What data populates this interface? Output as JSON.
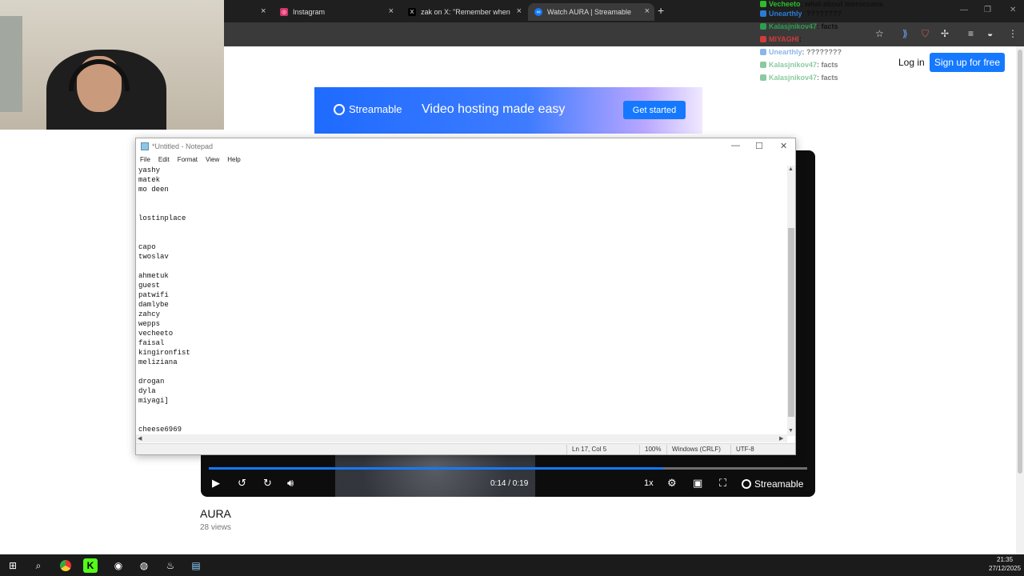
{
  "browser": {
    "tabs": [
      {
        "title": "Instagram",
        "icon": "instagram-icon",
        "active": false
      },
      {
        "title": "zak on X: \"Remember when xQ",
        "icon": "x-icon",
        "active": false
      },
      {
        "title": "Watch AURA | Streamable",
        "icon": "streamable-icon",
        "active": true
      }
    ],
    "new_tab": "+",
    "close_glyph": "×"
  },
  "streamable": {
    "login": "Log in",
    "signup": "Sign up for free",
    "banner": {
      "logo": "Streamable",
      "tagline": "Video hosting made easy",
      "cta": "Get started"
    },
    "player": {
      "time": "0:14 / 0:19",
      "progress": 0.76,
      "speed": "1x",
      "logo": "Streamable"
    },
    "video_title": "AURA",
    "views": "28 views"
  },
  "chat": [
    {
      "user": "Vecheeto",
      "color": "#2bbf2b",
      "msg": ": what about moroccans",
      "faded": false
    },
    {
      "user": "Unearthly",
      "color": "#2b7bd6",
      "msg": ": ????????",
      "faded": false
    },
    {
      "user": "Kalasjnikov47",
      "color": "#2b9f4f",
      "msg": ": facts",
      "faded": false
    },
    {
      "user": "MIYAGHI",
      "color": "#d23b3b",
      "msg": ":",
      "faded": false
    },
    {
      "user": "Unearthly",
      "color": "#2b7bd6",
      "msg": ": ????????",
      "faded": true
    },
    {
      "user": "Kalasjnikov47",
      "color": "#2b9f4f",
      "msg": ": facts",
      "faded": true
    },
    {
      "user": "Kalasjnikov47",
      "color": "#2b9f4f",
      "msg": ": facts",
      "faded": true
    }
  ],
  "notepad": {
    "title": "*Untitled - Notepad",
    "menu": [
      "File",
      "Edit",
      "Format",
      "View",
      "Help"
    ],
    "text": "yashy\nmatek\nmo deen\n\n\nlostinplace\n\n\ncapo\ntwoslav\n\nahmetuk\nguest\npatwifi\ndamlybe\nzahcy\nwepps\nvecheeto\nfaisal\nkingironfist\nmeliziana\n\ndrogan\ndyla\nmiyagi]\n\n\ncheese6969",
    "status": {
      "position": "Ln 17, Col 5",
      "zoom": "100%",
      "line_ending": "Windows (CRLF)",
      "encoding": "UTF-8"
    }
  },
  "taskbar": {
    "time": "21:35",
    "date": "27/12/2025"
  },
  "colors": {
    "accent": "#1479ff"
  }
}
